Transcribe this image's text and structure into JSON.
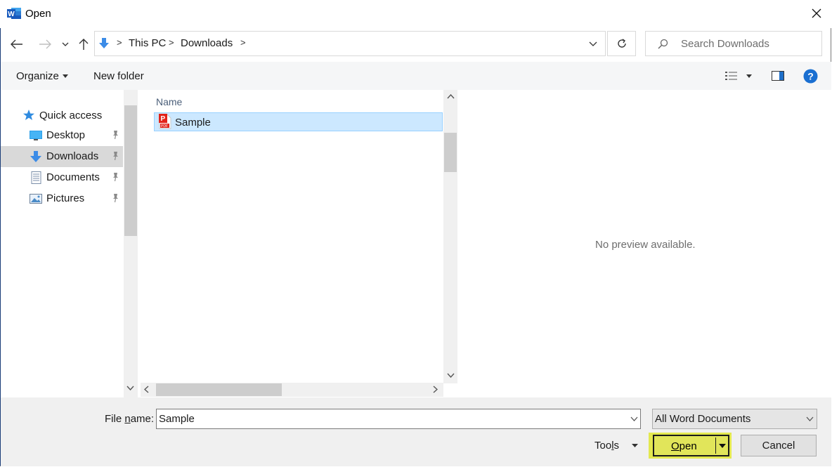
{
  "window": {
    "title": "Open"
  },
  "address": {
    "crumbs": [
      "This PC",
      "Downloads"
    ]
  },
  "search": {
    "placeholder": "Search Downloads"
  },
  "toolbar": {
    "organize": "Organize",
    "new_folder": "New folder"
  },
  "sidebar": {
    "quick_access": "Quick access",
    "items": [
      {
        "label": "Desktop",
        "icon": "desktop-icon"
      },
      {
        "label": "Downloads",
        "icon": "downloads-icon",
        "selected": true
      },
      {
        "label": "Documents",
        "icon": "documents-icon"
      },
      {
        "label": "Pictures",
        "icon": "pictures-icon"
      }
    ]
  },
  "file_list": {
    "column_name": "Name",
    "files": [
      {
        "name": "Sample",
        "icon": "pdf-icon",
        "selected": true
      }
    ]
  },
  "preview": {
    "text": "No preview available."
  },
  "footer": {
    "file_name_label_pre": "File ",
    "file_name_label_u": "n",
    "file_name_label_post": "ame:",
    "file_name_value": "Sample",
    "file_type": "All Word Documents",
    "tools_pre": "Too",
    "tools_u": "l",
    "tools_post": "s",
    "open_u": "O",
    "open_post": "pen",
    "cancel": "Cancel"
  },
  "colors": {
    "accent": "#0078d7",
    "selection": "#cce8ff",
    "open_highlight": "#e3e84f"
  }
}
